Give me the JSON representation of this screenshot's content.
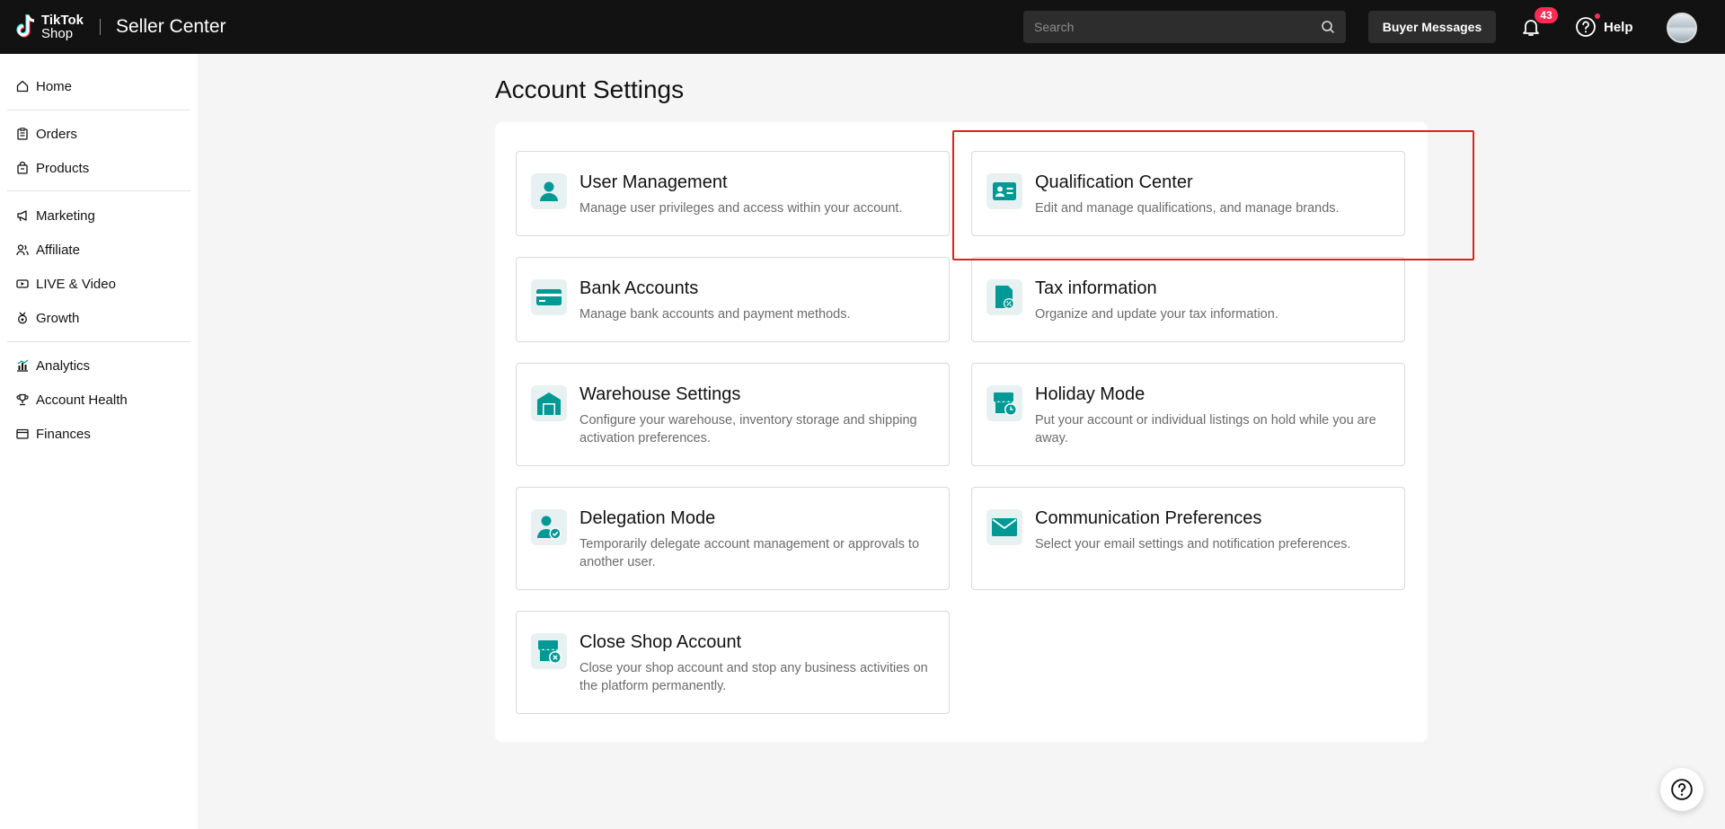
{
  "header": {
    "logo_line1": "TikTok",
    "logo_line2": "Shop",
    "app_title": "Seller Center",
    "search_placeholder": "Search",
    "buyer_messages_label": "Buyer Messages",
    "notification_count": "43",
    "help_label": "Help"
  },
  "sidebar": {
    "items": [
      {
        "label": "Home",
        "icon": "home-icon"
      },
      {
        "label": "Orders",
        "icon": "clipboard-icon"
      },
      {
        "label": "Products",
        "icon": "bag-icon"
      },
      {
        "label": "Marketing",
        "icon": "megaphone-icon"
      },
      {
        "label": "Affiliate",
        "icon": "people-icon"
      },
      {
        "label": "LIVE & Video",
        "icon": "video-icon"
      },
      {
        "label": "Growth",
        "icon": "medal-icon"
      },
      {
        "label": "Analytics",
        "icon": "bar-chart-icon"
      },
      {
        "label": "Account Health",
        "icon": "trophy-icon"
      },
      {
        "label": "Finances",
        "icon": "wallet-icon"
      }
    ]
  },
  "main": {
    "page_title": "Account Settings",
    "cards": [
      {
        "title": "User Management",
        "desc": "Manage user privileges and access within your account.",
        "icon": "user-icon"
      },
      {
        "title": "Qualification Center",
        "desc": "Edit and manage qualifications, and manage brands.",
        "icon": "id-card-icon"
      },
      {
        "title": "Bank Accounts",
        "desc": "Manage bank accounts and payment methods.",
        "icon": "bank-card-icon"
      },
      {
        "title": "Tax information",
        "desc": "Organize and update your tax information.",
        "icon": "tax-document-icon"
      },
      {
        "title": "Warehouse Settings",
        "desc": "Configure your warehouse, inventory storage and shipping activation preferences.",
        "icon": "warehouse-icon"
      },
      {
        "title": "Holiday Mode",
        "desc": "Put your account or individual listings on hold while you are away.",
        "icon": "store-clock-icon"
      },
      {
        "title": "Delegation Mode",
        "desc": "Temporarily delegate account management or approvals to another user.",
        "icon": "user-check-icon"
      },
      {
        "title": "Communication Preferences",
        "desc": "Select your email settings and notification preferences.",
        "icon": "envelope-icon"
      },
      {
        "title": "Close Shop Account",
        "desc": "Close your shop account and stop any business activities on the platform permanently.",
        "icon": "store-close-icon"
      }
    ]
  },
  "colors": {
    "accent": "#009995",
    "icon_bg": "#e7f1f1",
    "topbar": "#121212",
    "badge": "#fe2c55",
    "highlight": "#e02020"
  }
}
